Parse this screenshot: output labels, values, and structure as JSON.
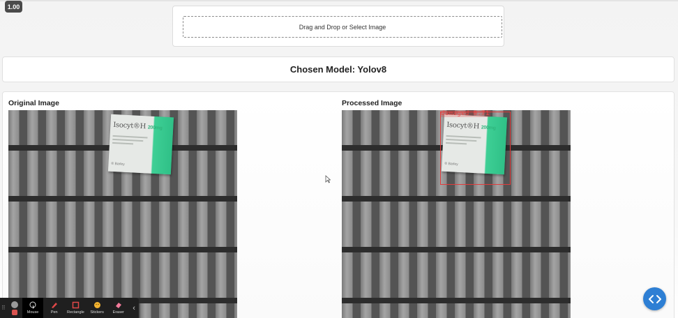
{
  "playback_speed": "1.00",
  "upload": {
    "dropzone_text": "Drag and Drop or Select Image"
  },
  "model": {
    "chosen_text": "Chosen Model: Yolov8"
  },
  "results": {
    "original_title": "Original Image",
    "processed_title": "Processed Image",
    "product_brand": "Isocyt",
    "product_brand_suffix": "®H",
    "product_dose": "200mg",
    "product_maker": "® Barley",
    "detection_label": "damaged  0.71"
  },
  "recorder_toolbar": {
    "tools": [
      {
        "label": "Mouse",
        "icon": "mouse-cursor-icon"
      },
      {
        "label": "Pen",
        "icon": "pen-icon"
      },
      {
        "label": "Rectangle",
        "icon": "rectangle-icon"
      },
      {
        "label": "Stickers",
        "icon": "sticker-icon"
      },
      {
        "label": "Eraser",
        "icon": "eraser-icon"
      }
    ]
  },
  "colors": {
    "detection_box": "#e23b3b",
    "product_accent": "#2fc087",
    "nav_button": "#2e7fd4"
  }
}
